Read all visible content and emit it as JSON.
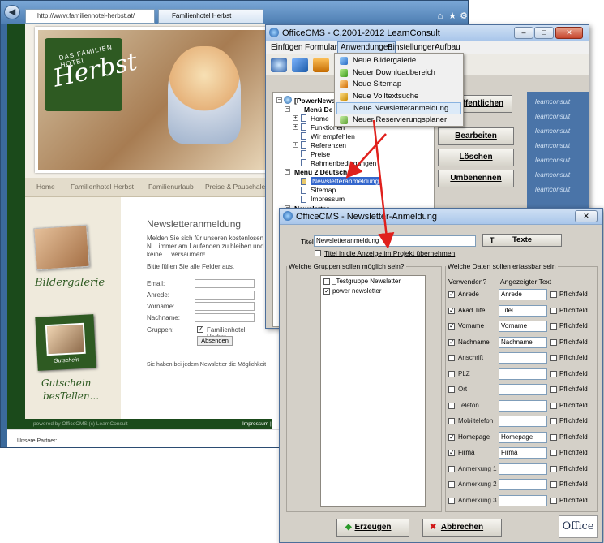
{
  "browser": {
    "address": "http://www.familienhotel-herbst.at/",
    "tab_title": "Familienhotel Herbst",
    "icons": [
      "home-icon",
      "star-icon",
      "gear-icon"
    ]
  },
  "site": {
    "logo_main": "Herbst",
    "logo_sub": "DAS FAMILIEN HOTEL",
    "nav": [
      "Home",
      "Familienhotel Herbst",
      "Familienurlaub",
      "Preise & Pauschalen"
    ],
    "heading": "Newsletteranmeldung",
    "intro": "Melden Sie sich für unseren kostenlosen N... immer am Laufenden zu bleiben und keine ... versäumen!",
    "fill_all": "Bitte füllen Sie alle Felder aus.",
    "fields": [
      "Email:",
      "Anrede:",
      "Vorname:",
      "Nachname:"
    ],
    "groups_label": "Gruppen:",
    "group_option": "Familienhotel Herbst",
    "submit": "Absenden",
    "unsubscribe_note": "Sie haben bei jedem Newsletter die Möglichkeit sich wie...",
    "gallery_caption": "Bildergalerie",
    "voucher_caption_1": "Gutschein",
    "voucher_caption_2": "besTellen...",
    "voucher_label": "Gutschein",
    "footer": "powered by OfficeCMS (c) LearnConsult",
    "footer_right": "Impressum | Re",
    "partner": "Unsere Partner:"
  },
  "cms": {
    "title": "OfficeCMS - C.2001-2012 LearnConsult",
    "menu": [
      "Einfügen",
      "Formular",
      "Anwendungen",
      "Einstellungen",
      "Aufbau"
    ],
    "dropdown": [
      "Neue Bildergalerie",
      "Neuer Downloadbereich",
      "Neue Sitemap",
      "Neue Volltextsuche",
      "Neue Newsletteranmeldung",
      "Neuer Reservierungsplaner"
    ],
    "tree": {
      "root": "[PowerNews]",
      "menu1": "Menü De",
      "items1": [
        "Home",
        "Funktionen",
        "Wir empfehlen",
        "Referenzen",
        "Preise",
        "Rahmenbedingungen"
      ],
      "menu2": "Menü 2 Deutsch",
      "items2": [
        "Newsletteranmeldung",
        "Sitemap",
        "Impressum"
      ],
      "newsletter": "Newsletter"
    },
    "buttons": [
      "Veröffentlichen",
      "Bearbeiten",
      "Löschen",
      "Umbenennen"
    ],
    "brand": "learnconsult"
  },
  "dialog": {
    "title": "OfficeCMS - Newsletter-Anmeldung",
    "title_label": "Titel",
    "title_value": "Newsletteranmeldung",
    "texte_button": "Texte",
    "show_title_label": "Titel in die Anzeige im Projekt übernehmen",
    "groups_legend": "Welche Gruppen sollen möglich sein?",
    "groups": [
      {
        "label": "_Testgruppe Newsletter",
        "checked": false
      },
      {
        "label": "power newsletter",
        "checked": true
      }
    ],
    "data_legend": "Welche Daten sollen erfassbar sein",
    "col_use": "Verwenden?",
    "col_text": "Angezeigter Text",
    "required_label": "Pflichtfeld",
    "fields": [
      {
        "label": "Anrede",
        "checked": true,
        "text": "Anrede"
      },
      {
        "label": "Akad.Titel",
        "checked": true,
        "text": "Titel"
      },
      {
        "label": "Vorname",
        "checked": true,
        "text": "Vorname"
      },
      {
        "label": "Nachname",
        "checked": true,
        "text": "Nachname"
      },
      {
        "label": "Anschrift",
        "checked": false,
        "text": ""
      },
      {
        "label": "PLZ",
        "checked": false,
        "text": ""
      },
      {
        "label": "Ort",
        "checked": false,
        "text": ""
      },
      {
        "label": "Telefon",
        "checked": false,
        "text": ""
      },
      {
        "label": "Mobiltelefon",
        "checked": false,
        "text": ""
      },
      {
        "label": "Homepage",
        "checked": true,
        "text": "Homepage"
      },
      {
        "label": "Firma",
        "checked": true,
        "text": "Firma"
      },
      {
        "label": "Anmerkung 1",
        "checked": false,
        "text": ""
      },
      {
        "label": "Anmerkung 2",
        "checked": false,
        "text": ""
      },
      {
        "label": "Anmerkung 3",
        "checked": false,
        "text": ""
      }
    ],
    "create_button": "Erzeugen",
    "cancel_button": "Abbrechen",
    "logo": "Office"
  },
  "colors": {
    "annotation_arrow": "#e0201c",
    "site_green": "#1b4a1b",
    "cms_blue": "#4a74a8"
  }
}
